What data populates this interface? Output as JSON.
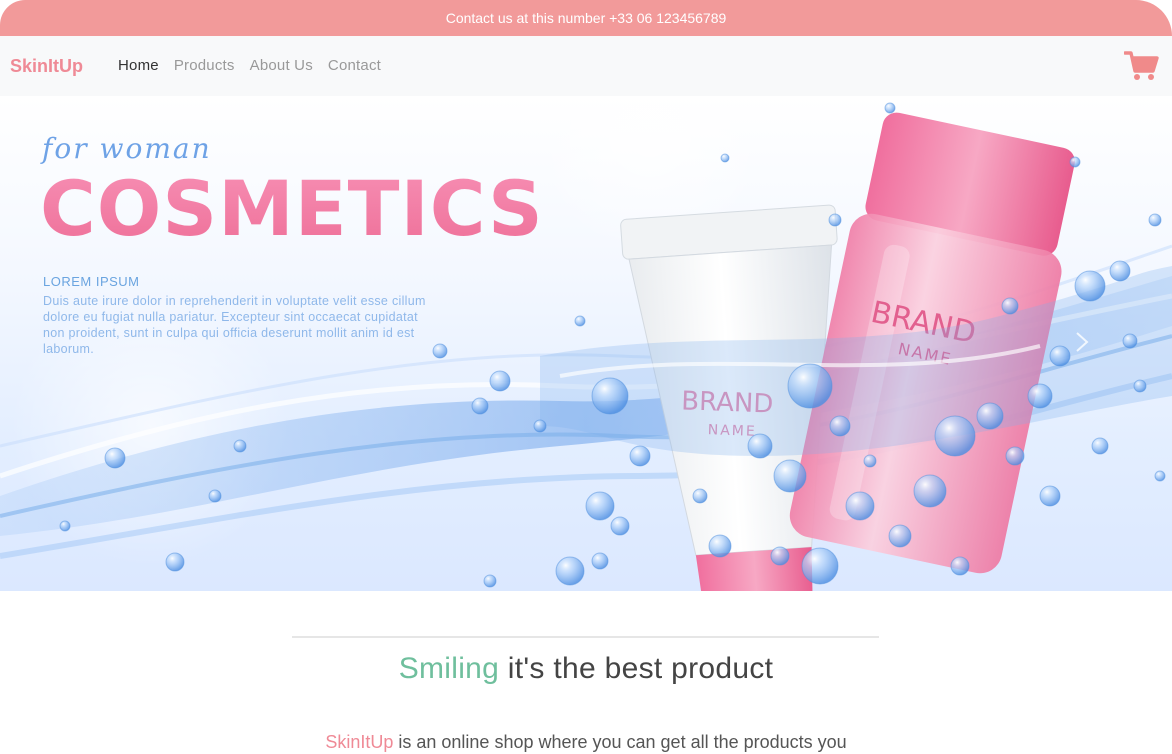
{
  "topbar": {
    "contact": "Contact us at this number +33 06 123456789"
  },
  "navbar": {
    "brand": "SkinItUp",
    "links": [
      "Home",
      "Products",
      "About Us",
      "Contact"
    ],
    "active": "Home",
    "cart_icon": "shopping-cart-icon",
    "brand_color": "#ef8a96"
  },
  "hero": {
    "tagline": "for woman",
    "title": "COSMETICS",
    "subheading": "LOREM IPSUM",
    "body": "Duis aute irure dolor in reprehenderit in voluptate velit esse cillum dolore eu fugiat nulla pariatur. Excepteur sint occaecat cupidatat non proident, sunt in culpa qui officia deserunt mollit anim id est laborum.",
    "tube_brand": "BRAND",
    "tube_name": "NAME",
    "bottle_brand": "BRAND",
    "bottle_name": "NAME",
    "next_icon": "chevron-right-icon"
  },
  "section": {
    "headline_accent": "Smiling",
    "headline_rest": "it's the best product",
    "intro_brand": "SkinItUp",
    "intro_rest": "is an online shop where you can get all the products you",
    "accent_color": "#6fbf9d"
  }
}
